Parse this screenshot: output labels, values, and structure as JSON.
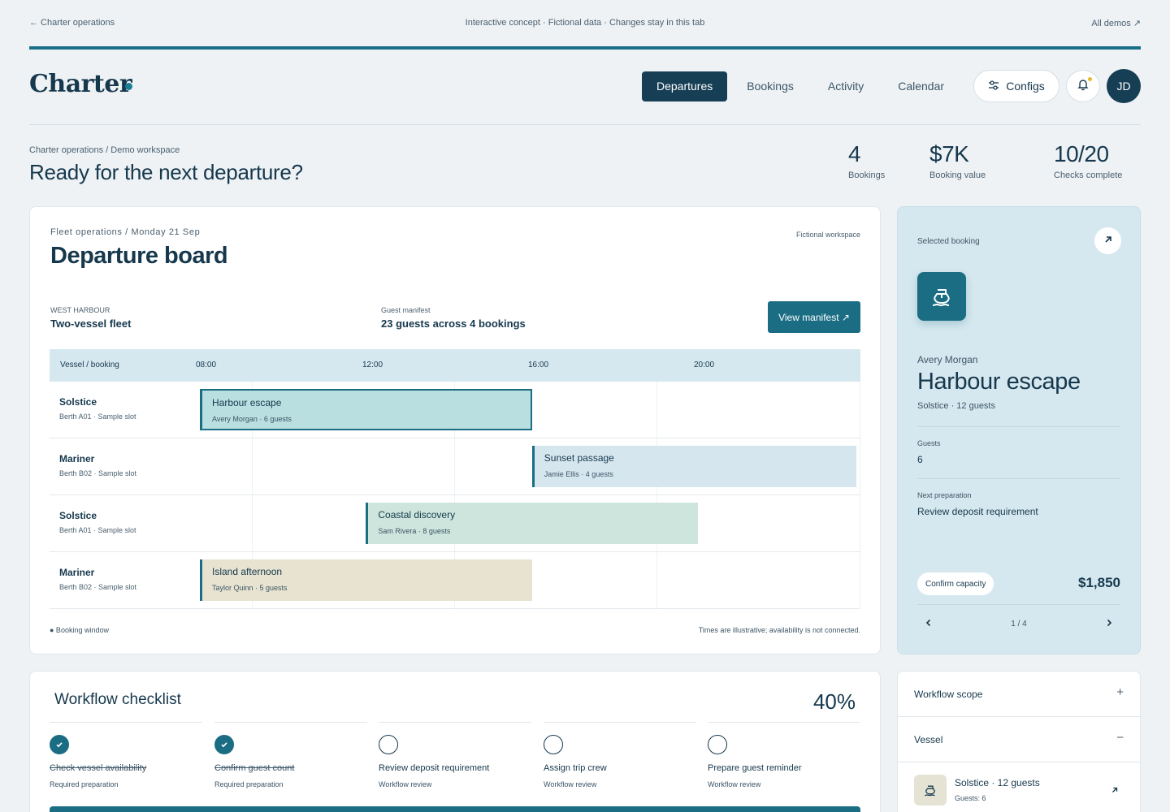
{
  "topbar": {
    "back": "← Charter operations",
    "notice": "Interactive concept · Fictional data · Changes stay in this tab",
    "all_demos": "All demos ↗"
  },
  "brand": {
    "name": "Charter"
  },
  "nav": {
    "tabs": [
      "Departures",
      "Bookings",
      "Activity",
      "Calendar"
    ],
    "active": "Departures"
  },
  "header": {
    "configs_label": "Configs",
    "avatar_initials": "JD"
  },
  "page": {
    "breadcrumb": "Charter operations / Demo workspace",
    "headline": "Ready for the next departure?"
  },
  "stats": [
    {
      "value": "4",
      "label": "Bookings"
    },
    {
      "value": "$7K",
      "label": "Booking value"
    },
    {
      "value": "10/20",
      "label": "Checks complete"
    }
  ],
  "board": {
    "eyebrow": "Fleet operations / Monday 21 Sep",
    "fictional": "Fictional workspace",
    "title": "Departure board",
    "harbour_label": "WEST HARBOUR",
    "harbour_value": "Two-vessel fleet",
    "manifest_label": "Guest manifest",
    "manifest_value": "23 guests across 4 bookings",
    "view_manifest": "View manifest ↗",
    "column_header": "Vessel / booking",
    "times": [
      "08:00",
      "12:00",
      "16:00",
      "20:00"
    ],
    "rows": [
      {
        "vessel": "Solstice",
        "berth": "Berth A01 · Sample slot",
        "booking": "Harbour escape",
        "detail": "Avery Morgan · 6 guests",
        "start": "08:00",
        "end": "16:00",
        "color": "#b9dfe0",
        "selected": true
      },
      {
        "vessel": "Mariner",
        "berth": "Berth B02 · Sample slot",
        "booking": "Sunset passage",
        "detail": "Jamie Ellis · 4 guests",
        "start": "16:00",
        "end": "24:00",
        "color": "#d6e6ef",
        "selected": false
      },
      {
        "vessel": "Solstice",
        "berth": "Berth A01 · Sample slot",
        "booking": "Coastal discovery",
        "detail": "Sam Rivera · 8 guests",
        "start": "12:00",
        "end": "20:00",
        "color": "#cde5dc",
        "selected": false
      },
      {
        "vessel": "Mariner",
        "berth": "Berth B02 · Sample slot",
        "booking": "Island afternoon",
        "detail": "Taylor Quinn · 5 guests",
        "start": "08:00",
        "end": "16:00",
        "color": "#e7e3d0",
        "selected": false
      }
    ],
    "legend": "● Booking window",
    "note": "Times are illustrative; availability is not connected."
  },
  "selected": {
    "label": "Selected booking",
    "guest_name": "Avery Morgan",
    "trip": "Harbour escape",
    "vessel": "Solstice · 12 guests",
    "guests_label": "Guests",
    "guests_value": "6",
    "prep_label": "Next preparation",
    "prep_value": "Review deposit requirement",
    "confirm": "Confirm capacity",
    "price": "$1,850",
    "pager": "1 / 4"
  },
  "checklist": {
    "title": "Workflow checklist",
    "percent": "40%",
    "progress": 0.4,
    "steps": [
      {
        "label": "Check vessel availability",
        "sub": "Required preparation",
        "done": true
      },
      {
        "label": "Confirm guest count",
        "sub": "Required preparation",
        "done": true
      },
      {
        "label": "Review deposit requirement",
        "sub": "Workflow review",
        "done": false
      },
      {
        "label": "Assign trip crew",
        "sub": "Workflow review",
        "done": false
      },
      {
        "label": "Prepare guest reminder",
        "sub": "Workflow review",
        "done": false
      }
    ]
  },
  "scope": {
    "workflow_label": "Workflow scope",
    "workflow_icon": "+",
    "vessel_label": "Vessel",
    "vessel_icon": "−",
    "item_title": "Solstice · 12 guests",
    "item_sub": "Guests: 6"
  },
  "colors": {
    "accent": "#1b6d84",
    "navy": "#163e55",
    "panel": "#d6e8ef"
  }
}
